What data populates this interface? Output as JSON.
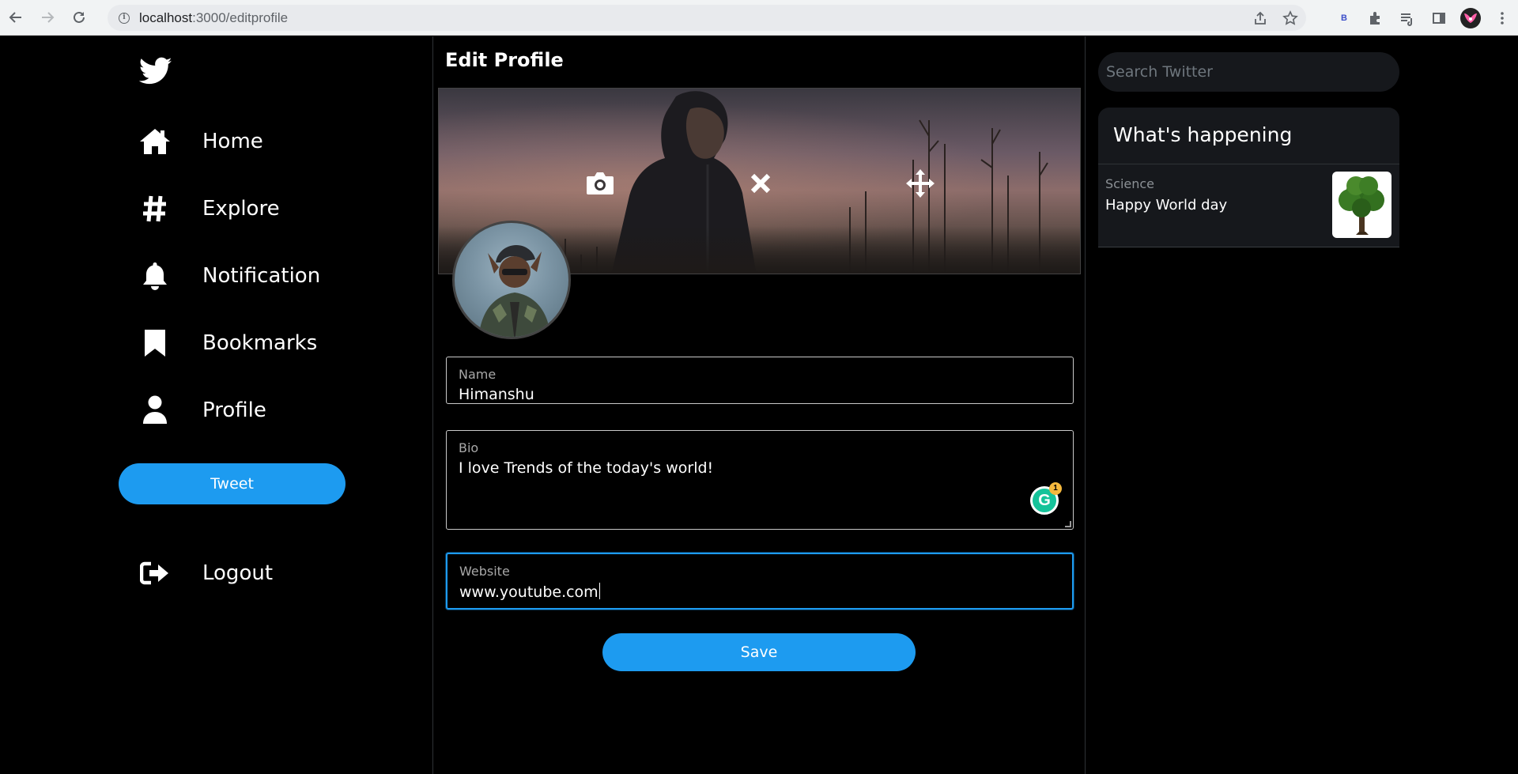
{
  "browser": {
    "url_host": "localhost",
    "url_path": ":3000/editprofile",
    "extension_badge": "B"
  },
  "sidebar": {
    "items": [
      {
        "label": "Home",
        "icon": "home-icon"
      },
      {
        "label": "Explore",
        "icon": "hashtag-icon"
      },
      {
        "label": "Notification",
        "icon": "bell-icon"
      },
      {
        "label": "Bookmarks",
        "icon": "bookmark-icon"
      },
      {
        "label": "Profile",
        "icon": "user-icon"
      }
    ],
    "tweet_label": "Tweet",
    "logout_label": "Logout"
  },
  "main": {
    "title": "Edit Profile",
    "fields": {
      "name": {
        "label": "Name",
        "value": "Himanshu"
      },
      "bio": {
        "label": "Bio",
        "value": "I love Trends of the today's world!"
      },
      "website": {
        "label": "Website",
        "value": "www.youtube.com"
      }
    },
    "grammarly_count": "1",
    "save_label": "Save"
  },
  "rightbar": {
    "search_placeholder": "Search Twitter",
    "happening_title": "What's happening",
    "trend": {
      "category": "Science",
      "title": "Happy World day"
    }
  },
  "colors": {
    "accent": "#1d9bf0",
    "background": "#000000",
    "panel": "#16181c"
  }
}
